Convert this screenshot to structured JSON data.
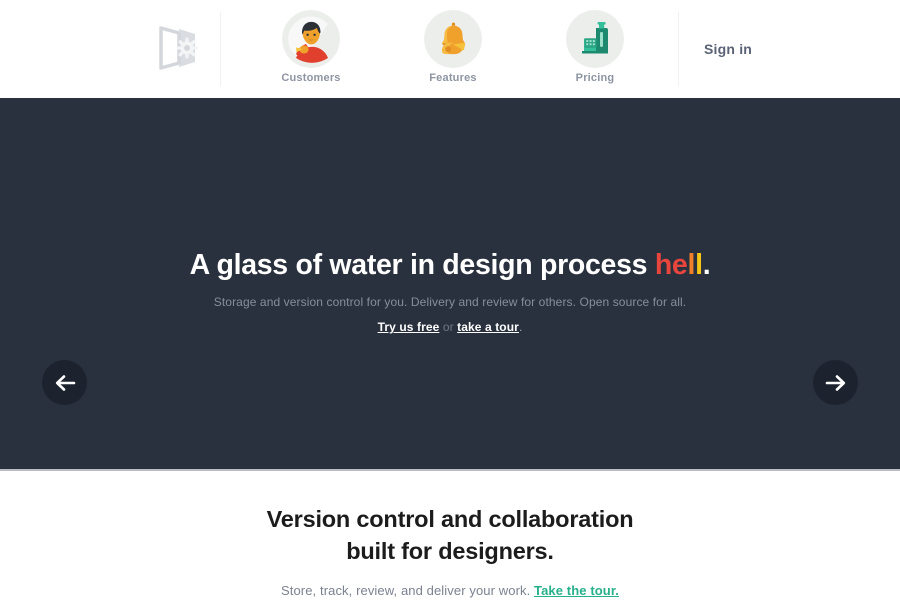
{
  "header": {
    "logo": {
      "name": "pixelapse-logo",
      "color": "#d7dade"
    },
    "nav_items": [
      {
        "label": "Customers",
        "icon": "customer-person-icon",
        "icon_bg": "#eef0ee"
      },
      {
        "label": "Features",
        "icon": "bell-whistle-icon",
        "icon_bg": "#eef0ee"
      },
      {
        "label": "Pricing",
        "icon": "cash-register-icon",
        "icon_bg": "#eef0ee"
      }
    ],
    "signin_label": "Sign in"
  },
  "hero": {
    "background_color": "#2a313e",
    "title_prefix": "A glass of water in design process ",
    "title_accent": {
      "h": "h",
      "e": "e",
      "l1": "l",
      "l2": "l",
      "dot": "."
    },
    "accent_colors": {
      "h": "#e8453c",
      "e": "#e8453c",
      "l1": "#f0802a",
      "l2": "#f5c518"
    },
    "subtitle": "Storage and version control for you. Delivery and review for others. Open source for all.",
    "cta_primary": "Try us free",
    "cta_separator": " or ",
    "cta_secondary": "take a tour",
    "cta_period": ".",
    "prev_arrow": "arrow-left",
    "next_arrow": "arrow-right"
  },
  "section": {
    "title_line1": "Version control and collaboration",
    "title_line2": "built for designers.",
    "subtitle": "Store, track, review, and deliver your work. ",
    "link_label": "Take the tour.",
    "link_color": "#27b08b"
  }
}
